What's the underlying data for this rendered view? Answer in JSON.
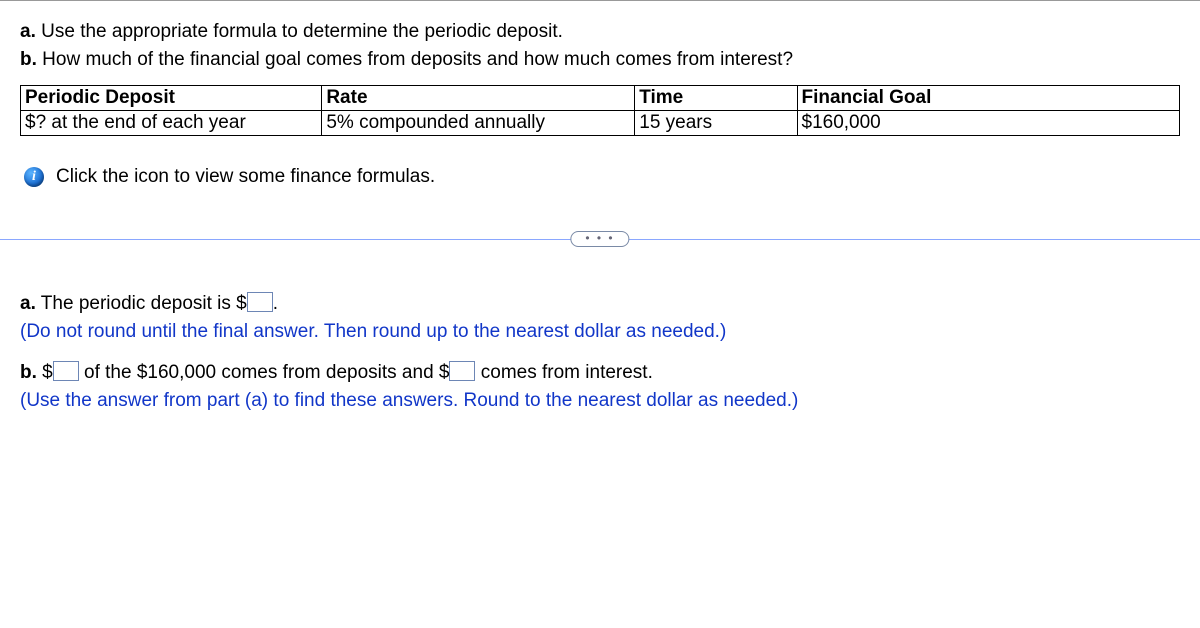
{
  "prompt": {
    "a_label": "a.",
    "a_text": "Use the appropriate formula to determine the periodic deposit.",
    "b_label": "b.",
    "b_text": "How much of the financial goal comes from deposits and how much comes from interest?"
  },
  "table": {
    "h1": "Periodic Deposit",
    "h2": "Rate",
    "h3": "Time",
    "h4": "Financial Goal",
    "r1": "$? at the end of each year",
    "r2": "5% compounded annually",
    "r3": "15 years",
    "r4": "$160,000"
  },
  "info": {
    "icon_glyph": "i",
    "text": "Click the icon to view some finance formulas."
  },
  "separator_label": "• • •",
  "answers": {
    "a_label": "a.",
    "a_prefix": "The periodic deposit is $",
    "a_suffix": ".",
    "a_value": "",
    "a_hint": "(Do not round until the final answer. Then round up to the nearest dollar as needed.)",
    "b_label": "b.",
    "b_p1_prefix": "$",
    "b_v1": "",
    "b_p1_mid": " of the $160,000 comes from deposits and $",
    "b_v2": "",
    "b_p1_suffix": " comes from interest.",
    "b_hint": "(Use the answer from part (a) to find these answers. Round to the nearest dollar as needed.)"
  }
}
